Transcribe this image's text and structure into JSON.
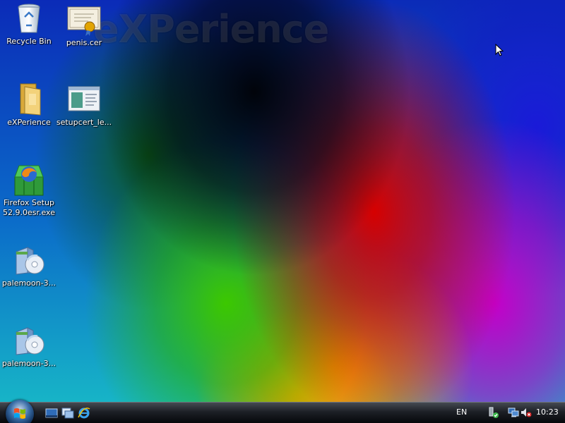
{
  "desktop": {
    "watermark": "eXPerience",
    "icons": [
      {
        "label": "Recycle Bin",
        "icon": "recycle-bin-icon"
      },
      {
        "label": "penis.cer",
        "icon": "certificate-icon"
      },
      {
        "label": "eXPerience",
        "icon": "folder-icon"
      },
      {
        "label": "setupcert_le...",
        "icon": "application-window-icon"
      },
      {
        "label_line1": "Firefox Setup",
        "label_line2": "52.9.0esr.exe",
        "icon": "firefox-installer-icon"
      },
      {
        "label": "palemoon-3...",
        "icon": "installer-box-icon"
      },
      {
        "label": "palemoon-3...",
        "icon": "installer-box-icon"
      }
    ]
  },
  "taskbar": {
    "start_icon": "windows-start-orb-icon",
    "quick_launch": [
      "show-desktop-icon",
      "switch-windows-icon",
      "internet-explorer-icon"
    ],
    "language": "EN",
    "tray_icons": [
      "safely-remove-hardware-icon",
      "network-icon",
      "volume-muted-icon"
    ],
    "clock": "10:23"
  },
  "colors": {
    "taskbar_top": "#454a52",
    "taskbar_bottom": "#05070a",
    "label_text": "#ffffff"
  }
}
